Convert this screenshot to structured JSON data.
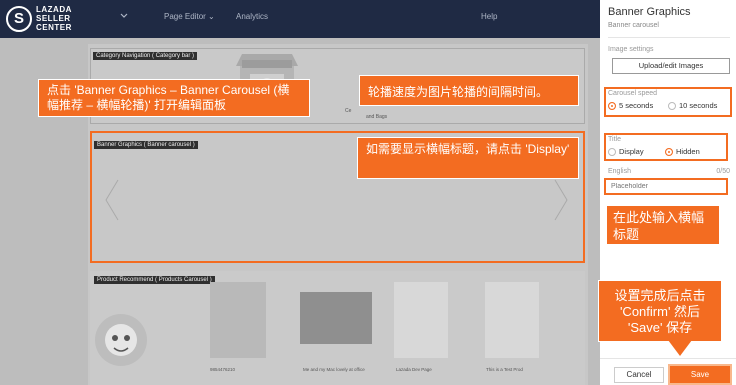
{
  "topbar": {
    "logo_letter": "S",
    "logo_lines": [
      "LAZADA",
      "SELLER",
      "CENTER"
    ],
    "chevron_icon": "chevron-down-icon",
    "page_editor": "Page Editor ⌄",
    "analytics": "Analytics",
    "help": "Help"
  },
  "editor": {
    "category_label": "Category Navigation ( Category bar )",
    "category_caption_1": "Ce",
    "category_caption_2": "and Bags",
    "banner_label": "Banner Graphics ( Banner carousel )",
    "product_label": "Product Recommend ( Products Carousel )",
    "product_captions": [
      "9854476210",
      "Me and my Mac lovely at office",
      "Lazada Dev Page",
      "This is a Test Prod"
    ]
  },
  "callouts": {
    "open_panel": "点击 'Banner Graphics – Banner Carousel (横幅推荐 – 横幅轮播)' 打开编辑面板",
    "speed_tip": "轮播速度为图片轮播的间隔时间。",
    "display_tip": "如需要显示横幅标题，请点击 'Display'",
    "title_tip": "在此处输入横幅标题",
    "save_tip": "设置完成后点击 'Confirm' 然后 'Save' 保存"
  },
  "panel": {
    "title": "Banner Graphics",
    "subtitle": "Banner carousel",
    "image_settings_label": "Image settings",
    "upload_button": "Upload/edit Images",
    "speed_label": "Carousel speed",
    "speed_options": [
      "5 seconds",
      "10 seconds"
    ],
    "speed_selected": "5 seconds",
    "title_label": "Title",
    "title_options": [
      "Display",
      "Hidden"
    ],
    "title_selected": "Hidden",
    "english_label": "English",
    "counter": "0/50",
    "placeholder": "Placeholder",
    "cancel_button": "Cancel",
    "save_button": "Save"
  },
  "colors": {
    "accent": "#f36c21",
    "topbar": "#1f2a44"
  }
}
